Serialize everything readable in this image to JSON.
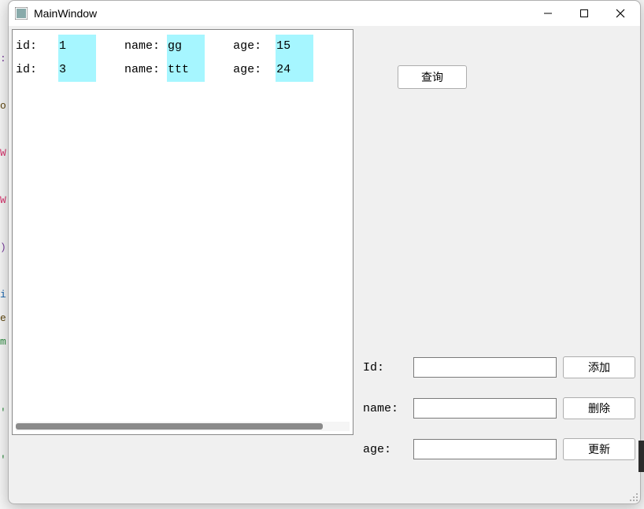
{
  "window": {
    "title": "MainWindow",
    "controls": {
      "minimize": "—",
      "maximize": "□",
      "close": "✕"
    }
  },
  "textview": {
    "label_id": "id:",
    "label_name": "name:",
    "label_age": "age:",
    "rows": [
      {
        "id": "1",
        "name": "gg",
        "age": "15"
      },
      {
        "id": "3",
        "name": "ttt",
        "age": "24"
      }
    ]
  },
  "buttons": {
    "query": "查询",
    "add": "添加",
    "delete": "删除",
    "update": "更新"
  },
  "form": {
    "id_label": "Id:",
    "name_label": "name:",
    "age_label": "age:",
    "id_value": "",
    "name_value": "",
    "age_value": ""
  },
  "colors": {
    "highlight_bg": "#a6f6ff",
    "window_bg": "#f0f0f0"
  },
  "icons": {
    "app": "app-icon",
    "minimize": "minimize-icon",
    "maximize": "maximize-icon",
    "close": "close-icon",
    "resize": "resize-grip-icon"
  }
}
